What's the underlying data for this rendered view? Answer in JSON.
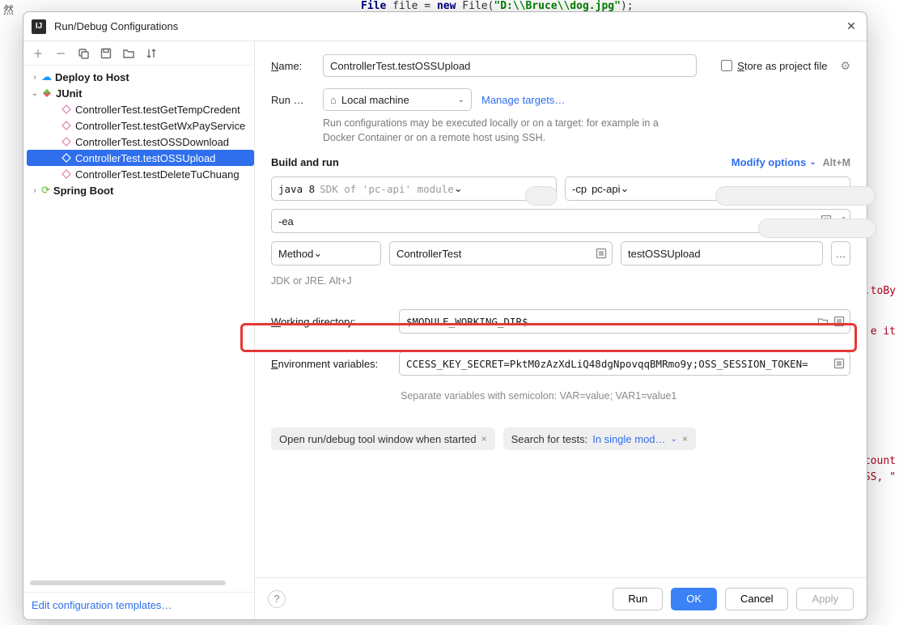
{
  "bg": {
    "left_char": "然",
    "code_line": "File file = new File(\"D:\\\\Bruce\\\\dog.jpg\");",
    "frag_toBy": ".toBy",
    "frag_e_it": "e it",
    "frag_count": "count",
    "frag_ss": "SS, \""
  },
  "dialog": {
    "title": "Run/Debug Configurations"
  },
  "tree": {
    "deploy": "Deploy to Host",
    "junit": "JUnit",
    "items": [
      "ControllerTest.testGetTempCredent",
      "ControllerTest.testGetWxPayService",
      "ControllerTest.testOSSDownload",
      "ControllerTest.testOSSUpload",
      "ControllerTest.testDeleteTuChuang"
    ],
    "spring": "Spring Boot"
  },
  "sidebar_footer": "Edit configuration templates…",
  "form": {
    "name_label": "Name:",
    "name_value": "ControllerTest.testOSSUpload",
    "store_label": "Store as project file",
    "run_on_label": "Run …",
    "run_on_value": "Local machine",
    "manage_targets": "Manage targets…",
    "run_hint": "Run configurations may be executed locally or on a target: for example in a Docker Container or on a remote host using SSH.",
    "build_title": "Build and run",
    "modify_options": "Modify options",
    "modify_shortcut": "Alt+M",
    "sdk_prefix": "java 8",
    "sdk_suffix": "SDK of 'pc-api' module",
    "cp_prefix": "-cp",
    "cp_value": "pc-api",
    "vm_options": "-ea",
    "method_label": "Method",
    "class_value": "ControllerTest",
    "method_value": "testOSSUpload",
    "jdk_hint": "JDK or JRE. Alt+J",
    "wd_label": "Working directory:",
    "wd_value": "$MODULE_WORKING_DIR$",
    "env_label": "Environment variables:",
    "env_value": "CCESS_KEY_SECRET=PktM0zAzXdLiQ48dgNpovqqBMRmo9y;OSS_SESSION_TOKEN=",
    "sep_hint": "Separate variables with semicolon: VAR=value; VAR1=value1",
    "chip1": "Open run/debug tool window when started",
    "chip2_prefix": "Search for tests:",
    "chip2_value": "In single mod…"
  },
  "footer": {
    "run": "Run",
    "ok": "OK",
    "cancel": "Cancel",
    "apply": "Apply"
  }
}
